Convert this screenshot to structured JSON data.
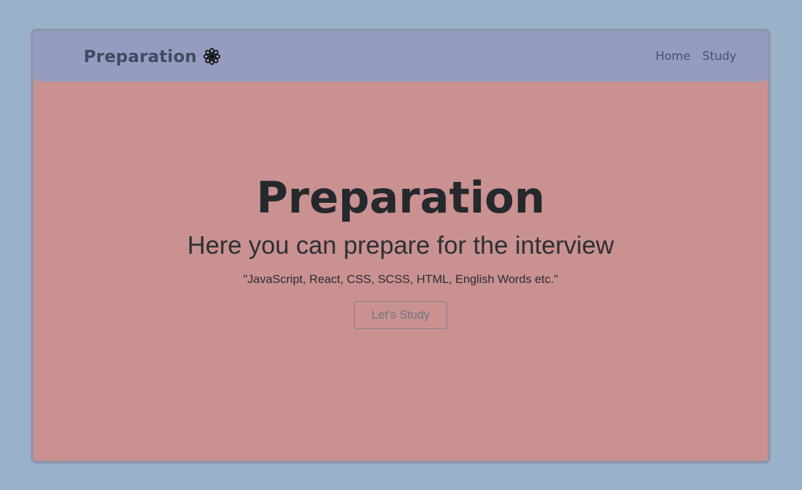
{
  "navbar": {
    "brand": "Preparation",
    "brand_icon": "flower-icon",
    "links": [
      "Home",
      "Study"
    ]
  },
  "hero": {
    "title": "Preparation",
    "subtitle": "Here you can prepare for the interview",
    "tags": "\"JavaScript, React, CSS, SCSS, HTML, English Words etc.\"",
    "button_label": "Let's Study"
  },
  "colors": {
    "page_background": "#9ab2c9",
    "frame_border": "#8c97ac",
    "navbar_background": "#959cc0",
    "content_background": "#c99190"
  }
}
